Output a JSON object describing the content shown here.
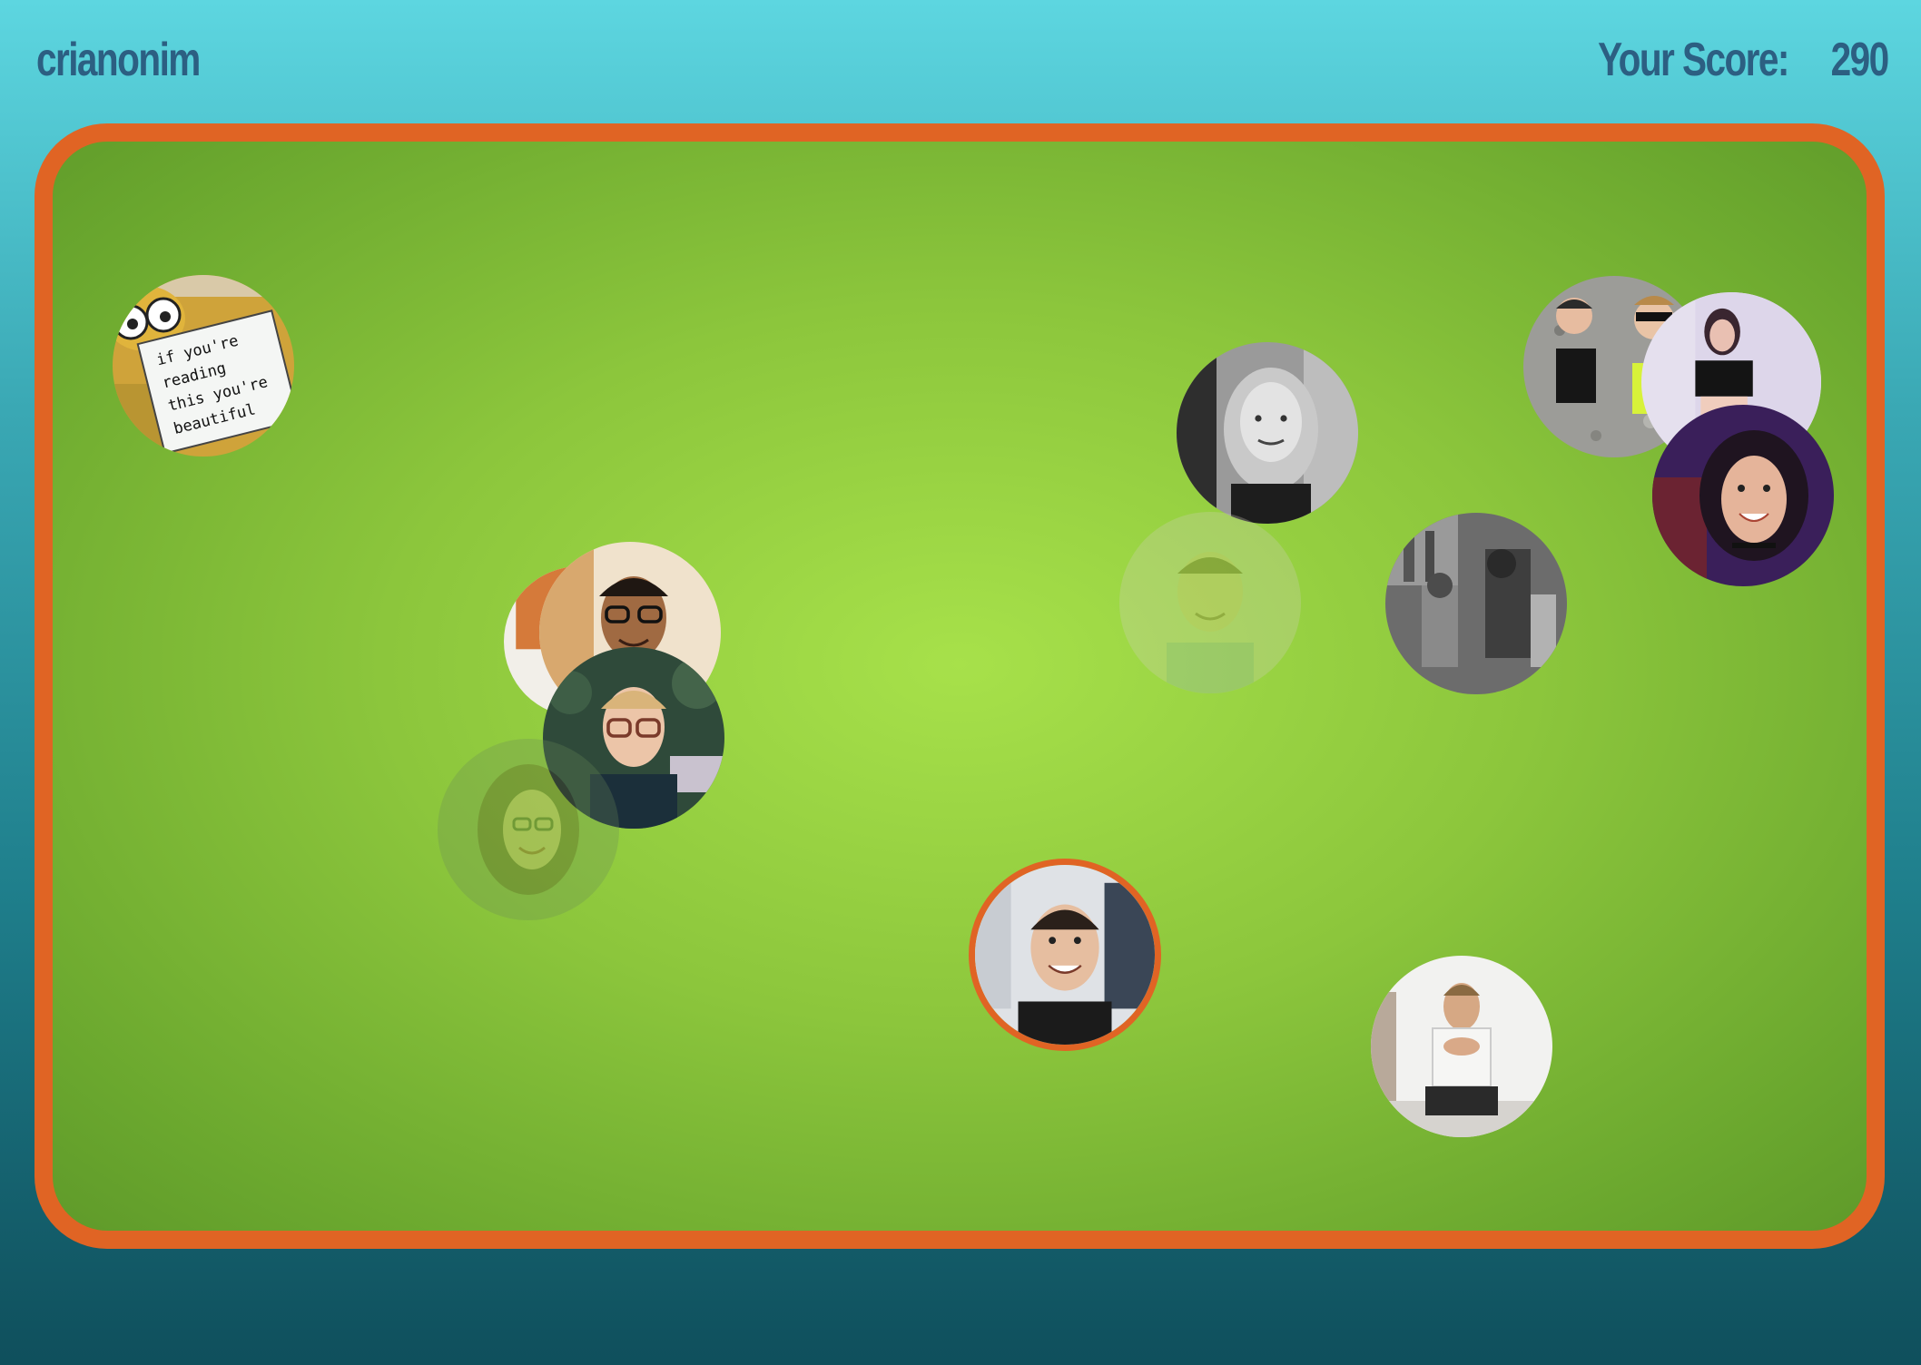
{
  "header": {
    "username": "crianonim",
    "score_label": "Your Score:",
    "score_value": "290"
  },
  "colors": {
    "board_border": "#e06424",
    "board_fill": "#8cc63c",
    "header_text": "#2c5f82"
  },
  "avatars": [
    {
      "name": "avatar-sign-cartoon",
      "faded": false,
      "selected": false,
      "sign_text": [
        "if you're",
        "reading",
        "this you're",
        "beautiful"
      ]
    },
    {
      "name": "avatar-woman-bw",
      "faded": false,
      "selected": false
    },
    {
      "name": "avatar-group-selfie",
      "faded": false,
      "selected": false
    },
    {
      "name": "avatar-woman-crop-top",
      "faded": false,
      "selected": false
    },
    {
      "name": "avatar-woman-smiling",
      "faded": false,
      "selected": false
    },
    {
      "name": "avatar-man-faded",
      "faded": true,
      "selected": false
    },
    {
      "name": "avatar-street-bw",
      "faded": false,
      "selected": false
    },
    {
      "name": "avatar-orange-back",
      "faded": false,
      "selected": false
    },
    {
      "name": "avatar-man-glasses-smiling",
      "faded": false,
      "selected": false
    },
    {
      "name": "avatar-man-glasses-blond",
      "faded": false,
      "selected": false
    },
    {
      "name": "avatar-woman-faded",
      "faded": true,
      "selected": false
    },
    {
      "name": "avatar-man-smiling",
      "faded": false,
      "selected": true
    },
    {
      "name": "avatar-man-sitting",
      "faded": false,
      "selected": false
    }
  ]
}
